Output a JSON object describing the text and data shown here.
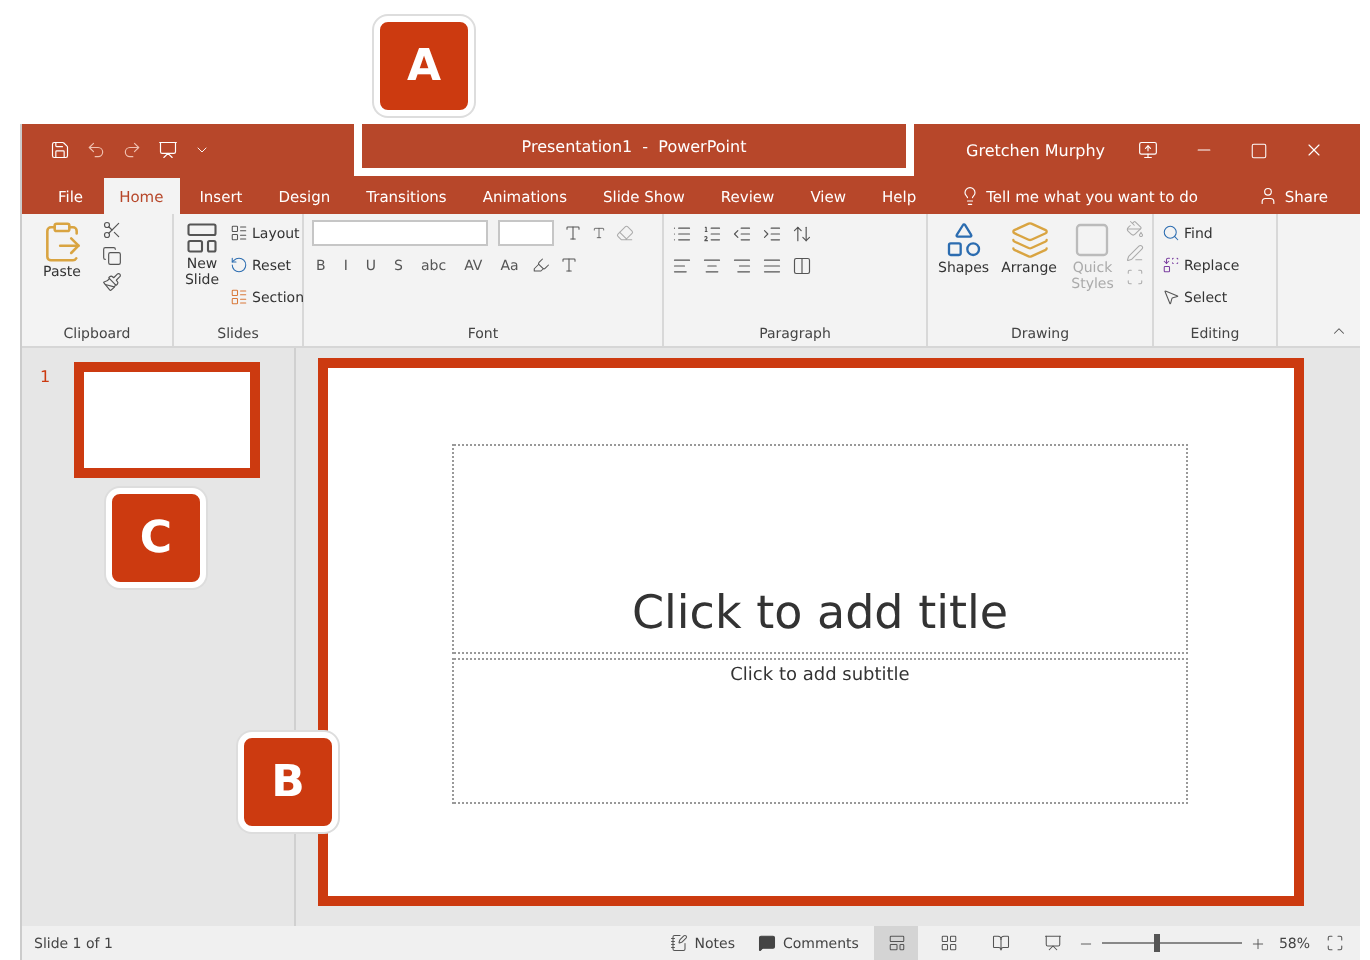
{
  "callouts": [
    {
      "label": "A"
    },
    {
      "label": "B"
    },
    {
      "label": "C"
    }
  ],
  "title_bar": {
    "title": "Presentation1  -  PowerPoint",
    "user": "Gretchen Murphy"
  },
  "tabs": [
    {
      "label": "File",
      "selected": false
    },
    {
      "label": "Home",
      "selected": true
    },
    {
      "label": "Insert",
      "selected": false
    },
    {
      "label": "Design",
      "selected": false
    },
    {
      "label": "Transitions",
      "selected": false
    },
    {
      "label": "Animations",
      "selected": false
    },
    {
      "label": "Slide Show",
      "selected": false
    },
    {
      "label": "Review",
      "selected": false
    },
    {
      "label": "View",
      "selected": false
    },
    {
      "label": "Help",
      "selected": false
    }
  ],
  "tell_me": "Tell me what you want to do",
  "share": "Share",
  "clipboard": {
    "label": "Clipboard",
    "paste": "Paste"
  },
  "slides": {
    "label": "Slides",
    "new_slide": "New Slide",
    "layout": "Layout",
    "reset": "Reset",
    "section": "Section"
  },
  "font": {
    "label": "Font",
    "buttons": [
      "B",
      "I",
      "U",
      "S",
      "abc",
      "AV",
      "Aa"
    ]
  },
  "paragraph": {
    "label": "Paragraph"
  },
  "drawing": {
    "label": "Drawing",
    "shapes": "Shapes",
    "arrange": "Arrange",
    "quick_styles": {
      "label": "Quick Styles",
      "disabled": true
    }
  },
  "editing": {
    "label": "Editing",
    "find": "Find",
    "replace": "Replace",
    "select": "Select"
  },
  "thumbnails": [
    {
      "number": "1",
      "selected": true
    }
  ],
  "slide": {
    "title_placeholder": "Click to add title",
    "subtitle_placeholder": "Click to add subtitle"
  },
  "status_bar": {
    "slide_info": "Slide 1 of 1",
    "notes": "Notes",
    "comments": "Comments",
    "views": [
      {
        "kind": "normal",
        "selected": true
      },
      {
        "kind": "sorter",
        "selected": false
      },
      {
        "kind": "reading",
        "selected": false
      },
      {
        "kind": "slideshow",
        "selected": false
      }
    ],
    "zoom": {
      "level": 0.38,
      "reading": "58%"
    }
  }
}
